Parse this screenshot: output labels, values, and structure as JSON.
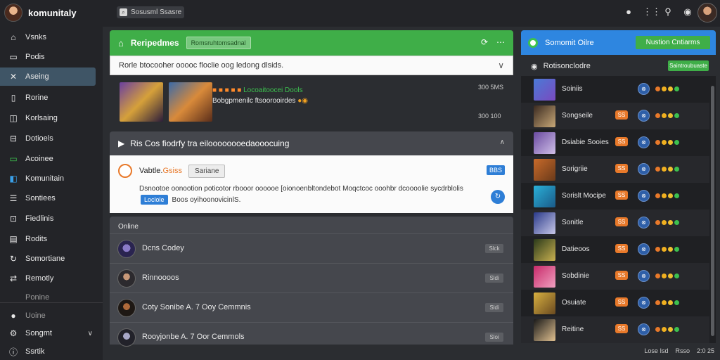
{
  "app": {
    "name": "komunitaly"
  },
  "search": {
    "label": "Sosusml Ssasre"
  },
  "sidebar": {
    "items": [
      {
        "label": "Vsnks",
        "icon": "home-icon"
      },
      {
        "label": "Podis",
        "icon": "document-icon"
      },
      {
        "label": "Aseing",
        "icon": "tools-icon"
      },
      {
        "label": "Rorine",
        "icon": "bookmark-icon"
      },
      {
        "label": "Korlsaing",
        "icon": "shop-icon"
      },
      {
        "label": "Dotioels",
        "icon": "settings-icon"
      },
      {
        "label": "Acoinee",
        "icon": "chat-icon"
      },
      {
        "label": "Komunitain",
        "icon": "community-icon"
      },
      {
        "label": "Sontiees",
        "icon": "list-icon"
      },
      {
        "label": "Fiedlinis",
        "icon": "grid-icon"
      },
      {
        "label": "Rodits",
        "icon": "file-icon"
      },
      {
        "label": "Somortiane",
        "icon": "refresh-icon"
      },
      {
        "label": "Remotly",
        "icon": "shuffle-icon"
      },
      {
        "label": "Ponine",
        "icon": "blank-icon"
      }
    ],
    "bottom": [
      {
        "label": "Uoine",
        "icon": "circle-icon"
      },
      {
        "label": "Songmt",
        "icon": "gear-icon"
      },
      {
        "label": "Ssrtik",
        "icon": "info-icon"
      }
    ]
  },
  "feed": {
    "header": "Reripedmes",
    "tag": "Romsruhtomsadnal",
    "search_text": "Rorle btocooher ooooc floclie oog ledong dlsids.",
    "post_title": "Locoaitoocei Dools",
    "post_title_prefix": "■ ■ ■ ■ ■",
    "post_sub": "Bobgpmenilc ftsoorooirdes",
    "meta1": "300 5MS",
    "meta2": "300 100"
  },
  "post": {
    "header": "Ris Cos fiodrfy tra eiloooooooedaooocuing",
    "author": "Vabtle.",
    "author_accent": "Gsiss",
    "author_tag": "Sariane",
    "badge": "BBS",
    "text": "Dsnootoe oonootion poticotor rbooor oooooe [oionoenbltondebot Moqctcoc ooohbr dcoooolie sycdrblolis",
    "button": "Loclole",
    "text2": "Boos oyihoonovicinlS."
  },
  "online": {
    "label": "Online",
    "users": [
      {
        "name": "Dcns Codey",
        "button": "Slck"
      },
      {
        "name": "Rinnoooos",
        "button": "Sldi"
      },
      {
        "name": "Coty Sonibe A. 7 Ooy Cemmnis",
        "button": "Sldi"
      },
      {
        "name": "Rooyjonbe A. 7 Oor Cemmols",
        "button": "Sloi"
      }
    ]
  },
  "right": {
    "header": "Somomit Oilre",
    "header_button": "Nustion Cntiarms",
    "sub": "Rotisonclodre",
    "sub_button": "Saintroubuaste",
    "items": [
      {
        "name": "Soiniis",
        "orange": "",
        "colors": [
          "#4a7ad6",
          "#7a4ac0"
        ]
      },
      {
        "name": "Songseile",
        "orange": "SS",
        "colors": [
          "#3a2a20",
          "#c8a878"
        ]
      },
      {
        "name": "Dsiabie Sooies",
        "orange": "SS",
        "colors": [
          "#6a4aa0",
          "#d0c0e8"
        ]
      },
      {
        "name": "Sorigriie",
        "orange": "SS",
        "colors": [
          "#c86a2a",
          "#6a3a1a"
        ]
      },
      {
        "name": "Sorislt Mocipe",
        "orange": "SS",
        "colors": [
          "#2ab0d8",
          "#1a5a88"
        ]
      },
      {
        "name": "Sonitle",
        "orange": "SS",
        "colors": [
          "#2a3a8a",
          "#c8c8e8"
        ]
      },
      {
        "name": "Datieoos",
        "orange": "SS",
        "colors": [
          "#2a3a1a",
          "#c8b050"
        ]
      },
      {
        "name": "Sobdinie",
        "orange": "SS",
        "colors": [
          "#c82a6a",
          "#f0a0c0"
        ]
      },
      {
        "name": "Osuiate",
        "orange": "SS",
        "colors": [
          "#d8b040",
          "#6a4a20"
        ]
      },
      {
        "name": "Reitine",
        "orange": "SS",
        "colors": [
          "#1a1a1a",
          "#e0c090"
        ]
      }
    ]
  },
  "footer": {
    "a": "Lose Isd",
    "b": "Rsso",
    "c": "2:0 25"
  }
}
